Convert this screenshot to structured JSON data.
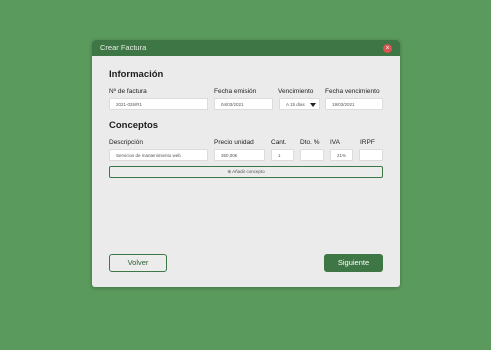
{
  "modal": {
    "title": "Crear Factura",
    "close_glyph": "×"
  },
  "informacion": {
    "heading": "Información",
    "labels": {
      "numero": "Nº de factura",
      "emision": "Fecha emisión",
      "vencimiento": "Vencimiento",
      "fecha_vencimiento": "Fecha vencimiento"
    },
    "values": {
      "numero": "2021-026/R1",
      "emision": "04/03/2021",
      "vencimiento": "A 15 días",
      "fecha_vencimiento": "19/03/2021"
    }
  },
  "conceptos": {
    "heading": "Conceptos",
    "labels": {
      "descripcion": "Descripción",
      "precio": "Precio unidad",
      "cant": "Cant.",
      "dto": "Dto. %",
      "iva": "IVA",
      "irpf": "IRPF"
    },
    "row": {
      "descripcion": "Servicios de mantenimiento web",
      "precio": "350,00€",
      "cant": "1",
      "dto": "",
      "iva": "21%",
      "irpf": ""
    },
    "add_label": "⊕ Añadir concepto"
  },
  "actions": {
    "back": "Volver",
    "next": "Siguiente"
  },
  "colors": {
    "background": "#5b9a5d",
    "primary": "#3f7645",
    "close": "#d9544f"
  }
}
